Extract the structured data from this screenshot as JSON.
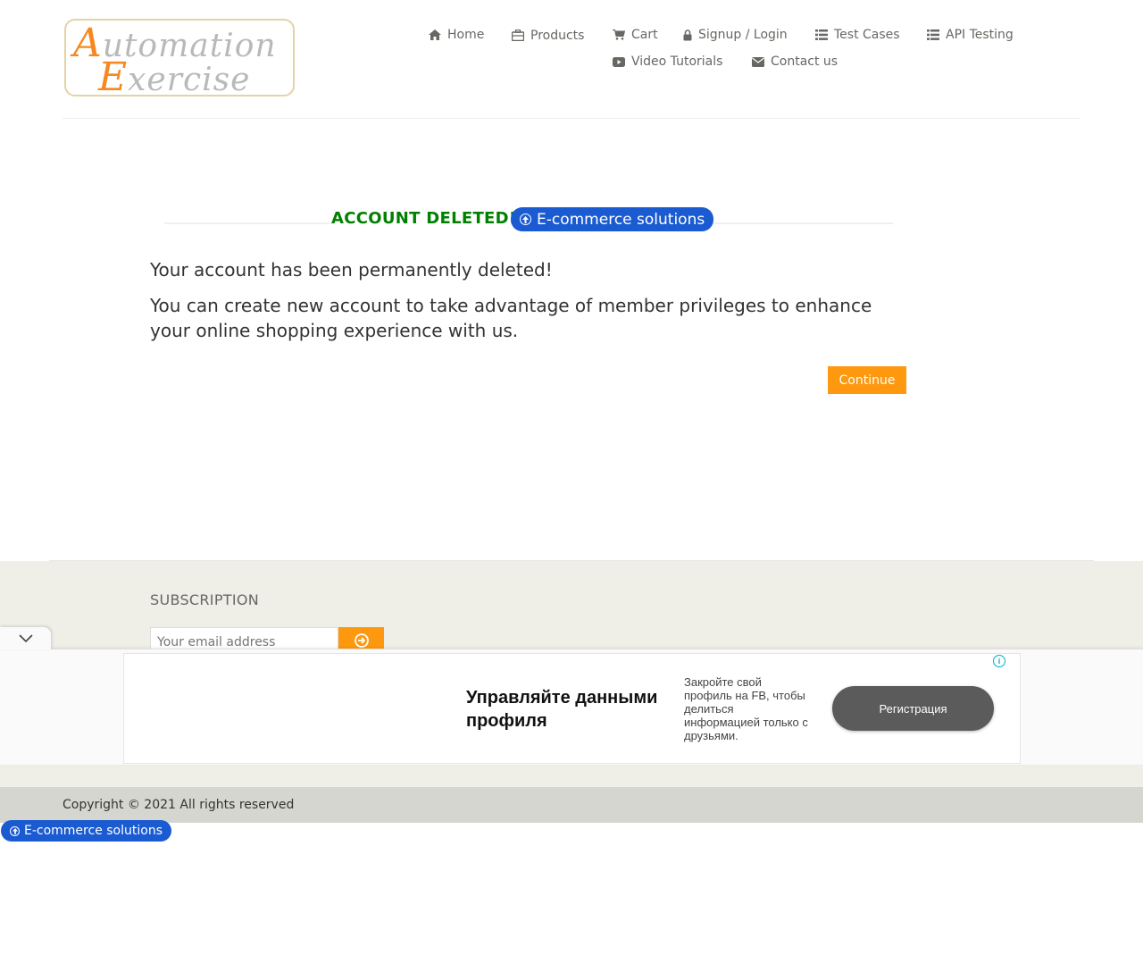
{
  "logo": {
    "line1_cap": "A",
    "line1_rest": "utomation",
    "line2_cap": "E",
    "line2_rest": "xercise"
  },
  "nav": {
    "home": "Home",
    "products": "Products",
    "cart": "Cart",
    "signup_login": "Signup / Login",
    "test_cases": "Test Cases",
    "api_testing": "API Testing",
    "video_tutorials": "Video Tutorials",
    "contact_us": "Contact us"
  },
  "main": {
    "title": "ACCOUNT DELETED!",
    "message1": "Your account has been permanently deleted!",
    "message2": "You can create new account to take advantage of member privileges to enhance your online shopping experience with us.",
    "continue_label": "Continue"
  },
  "badges": {
    "ecommerce": "E-commerce solutions"
  },
  "footer": {
    "subscription_title": "SUBSCRIPTION",
    "email_placeholder": "Your email address",
    "copyright": "Copyright © 2021 All rights reserved"
  },
  "ad": {
    "headline": "Управляйте данными профиля",
    "body": "Закройте свой профиль на FB, чтобы делиться информацией только с друзьями.",
    "cta": "Регистрация",
    "info": "i"
  },
  "colors": {
    "accent": "#fe980f",
    "title_green": "#008000",
    "badge_blue": "#1a5bd2",
    "footer_bg": "#efeee7",
    "copyright_bg": "#d6d6d0"
  }
}
